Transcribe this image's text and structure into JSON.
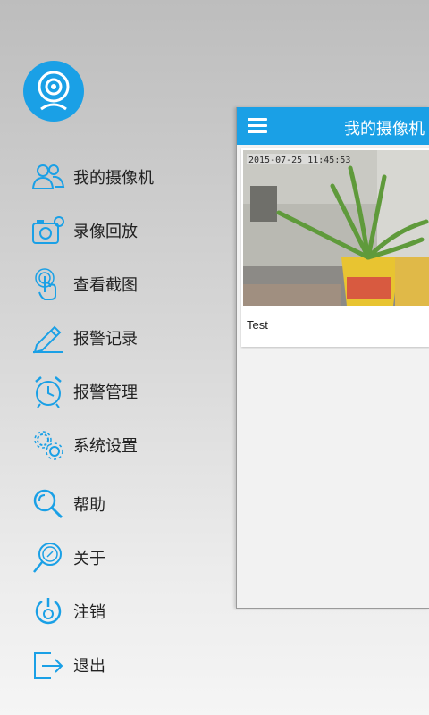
{
  "accent_color": "#1aa0e6",
  "header": {
    "title": "我的摄像机"
  },
  "menu": {
    "items": [
      {
        "label": "我的摄像机",
        "icon": "users-icon"
      },
      {
        "label": "录像回放",
        "icon": "camera-record-icon"
      },
      {
        "label": "查看截图",
        "icon": "touch-icon"
      },
      {
        "label": "报警记录",
        "icon": "pencil-icon"
      },
      {
        "label": "报警管理",
        "icon": "alarm-clock-icon"
      },
      {
        "label": "系统设置",
        "icon": "gears-icon"
      },
      {
        "label": "帮助",
        "icon": "search-icon"
      },
      {
        "label": "关于",
        "icon": "info-magnifier-icon"
      },
      {
        "label": "注销",
        "icon": "power-icon"
      },
      {
        "label": "退出",
        "icon": "exit-icon"
      }
    ]
  },
  "camera": {
    "name": "Test",
    "timestamp": "2015-07-25  11:45:53"
  }
}
